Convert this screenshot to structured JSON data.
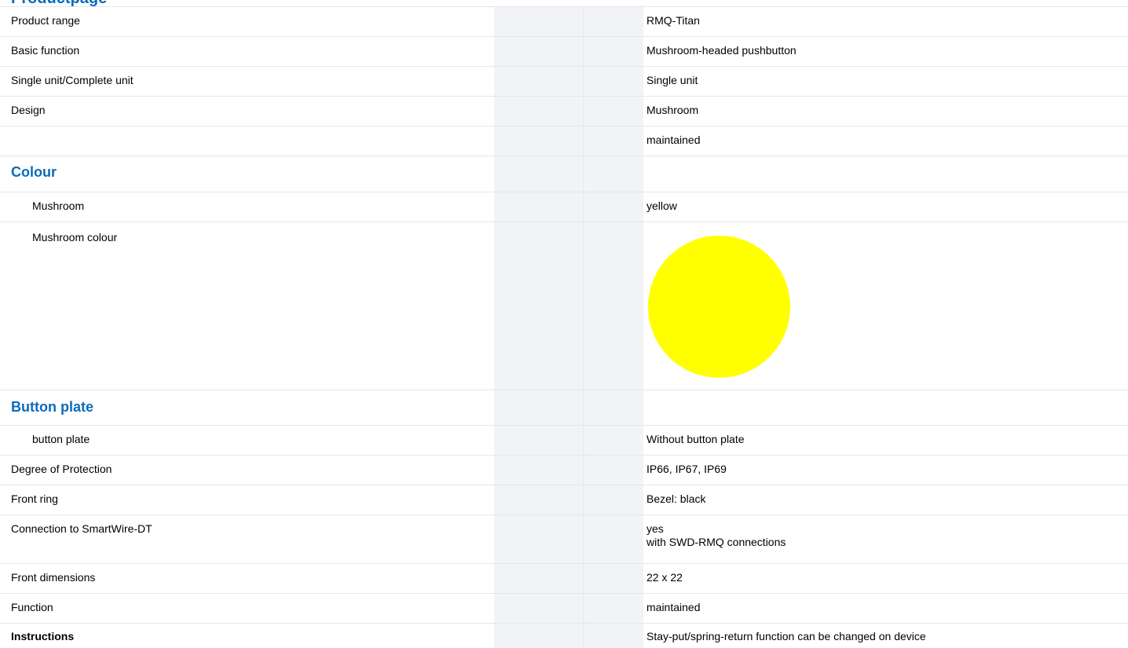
{
  "header": {
    "clipped_title": "Productpage"
  },
  "colors": {
    "accent": "#0b6bbb",
    "mushroom_swatch": "#ffff00"
  },
  "rows": [
    {
      "label": "Product range",
      "value": "RMQ-Titan"
    },
    {
      "label": "Basic function",
      "value": "Mushroom-headed pushbutton"
    },
    {
      "label": "Single unit/Complete unit",
      "value": "Single unit"
    },
    {
      "label": "Design",
      "value": "Mushroom"
    },
    {
      "label": "",
      "value": "maintained"
    }
  ],
  "colour_section": {
    "title": "Colour",
    "mushroom": {
      "label": "Mushroom",
      "value": "yellow"
    },
    "mushroom_colour": {
      "label": "Mushroom colour"
    }
  },
  "button_plate_section": {
    "title": "Button plate",
    "button_plate": {
      "label": "button plate",
      "value": "Without button plate"
    }
  },
  "rows2": [
    {
      "label": "Degree of Protection",
      "value": "IP66, IP67, IP69"
    },
    {
      "label": "Front ring",
      "value": "Bezel: black"
    },
    {
      "label": "Connection to SmartWire-DT",
      "value_line1": "yes",
      "value_line2": "with SWD-RMQ connections"
    },
    {
      "label": "Front dimensions",
      "value": "22 x 22"
    },
    {
      "label": "Function",
      "value": "maintained"
    },
    {
      "label": "Instructions",
      "value": "Stay-put/spring-return function can be changed on device"
    }
  ]
}
